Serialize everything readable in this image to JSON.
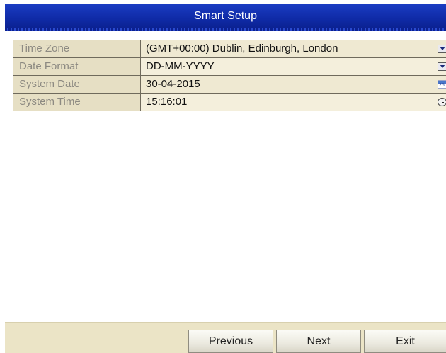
{
  "window": {
    "title": "Smart Setup"
  },
  "form": {
    "rows": [
      {
        "label": "Time Zone",
        "value": "(GMT+00:00) Dublin, Edinburgh, London",
        "control_icon": "dropdown-icon"
      },
      {
        "label": "Date Format",
        "value": "DD-MM-YYYY",
        "control_icon": "dropdown-icon"
      },
      {
        "label": "System Date",
        "value": "30-04-2015",
        "control_icon": "calendar-icon",
        "icon_text": "26"
      },
      {
        "label": "System Time",
        "value": "15:16:01",
        "control_icon": "clock-icon"
      }
    ]
  },
  "footer": {
    "previous_label": "Previous",
    "next_label": "Next",
    "exit_label": "Exit"
  },
  "colors": {
    "title_bar": "#0f2aa6",
    "panel_bg": "#efe9d2",
    "label_text": "#8d8a82"
  }
}
